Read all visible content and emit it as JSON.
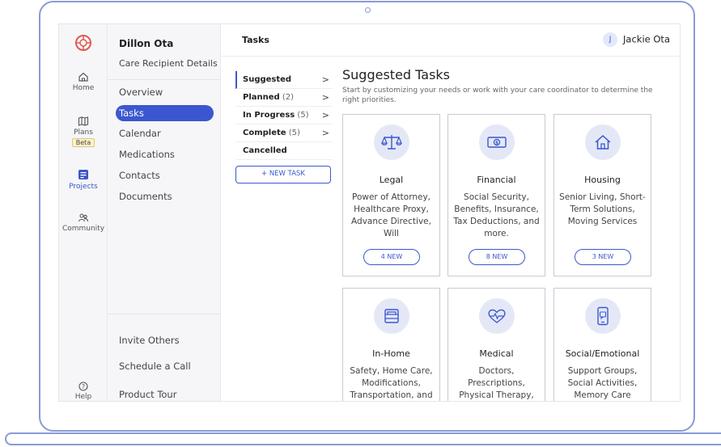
{
  "user": {
    "initial": "J",
    "name": "Jackie Ota"
  },
  "page_title": "Tasks",
  "rail": [
    {
      "label": "Home",
      "icon": "home-icon"
    },
    {
      "label": "Plans",
      "badge": "Beta",
      "icon": "map-icon"
    },
    {
      "label": "Projects",
      "icon": "clipboard-icon"
    },
    {
      "label": "Community",
      "icon": "community-icon"
    },
    {
      "label": "Help",
      "icon": "help-icon"
    }
  ],
  "subnav": {
    "name": "Dillon Ota",
    "details": "Care Recipient Details",
    "links": [
      "Overview",
      "Tasks",
      "Calendar",
      "Medications",
      "Contacts",
      "Documents"
    ],
    "bottom": [
      "Invite Others",
      "Schedule a Call",
      "Product Tour"
    ]
  },
  "filters": [
    {
      "label": "Suggested",
      "count": "",
      "chevron": ">"
    },
    {
      "label": "Planned",
      "count": "(2)",
      "chevron": ">"
    },
    {
      "label": "In Progress",
      "count": "(5)",
      "chevron": ">"
    },
    {
      "label": "Complete",
      "count": "(5)",
      "chevron": ">"
    },
    {
      "label": "Cancelled",
      "count": "",
      "chevron": ""
    }
  ],
  "new_task_label": "+ NEW TASK",
  "suggested": {
    "title": "Suggested Tasks",
    "subtitle": "Start by customizing your needs or work with your care coordinator to determine the right priorities."
  },
  "cards": [
    {
      "title": "Legal",
      "desc": "Power of Attorney, Healthcare Proxy, Advance Directive, Will",
      "pill": "4 NEW",
      "icon": "scale-icon"
    },
    {
      "title": "Financial",
      "desc": "Social Security, Benefits, Insurance, Tax Deductions, and more.",
      "pill": "8 NEW",
      "icon": "money-icon"
    },
    {
      "title": "Housing",
      "desc": "Senior Living, Short-Term Solutions, Moving Services",
      "pill": "3 NEW",
      "icon": "house-icon"
    },
    {
      "title": "In-Home",
      "desc": "Safety, Home Care, Modifications, Transportation, and",
      "pill": "",
      "icon": "bed-icon"
    },
    {
      "title": "Medical",
      "desc": "Doctors, Prescriptions, Physical Therapy,",
      "pill": "",
      "icon": "heart-pulse-icon"
    },
    {
      "title": "Social/Emotional",
      "desc": "Support Groups, Social Activities, Memory Care",
      "pill": "",
      "icon": "phone-chat-icon"
    }
  ]
}
